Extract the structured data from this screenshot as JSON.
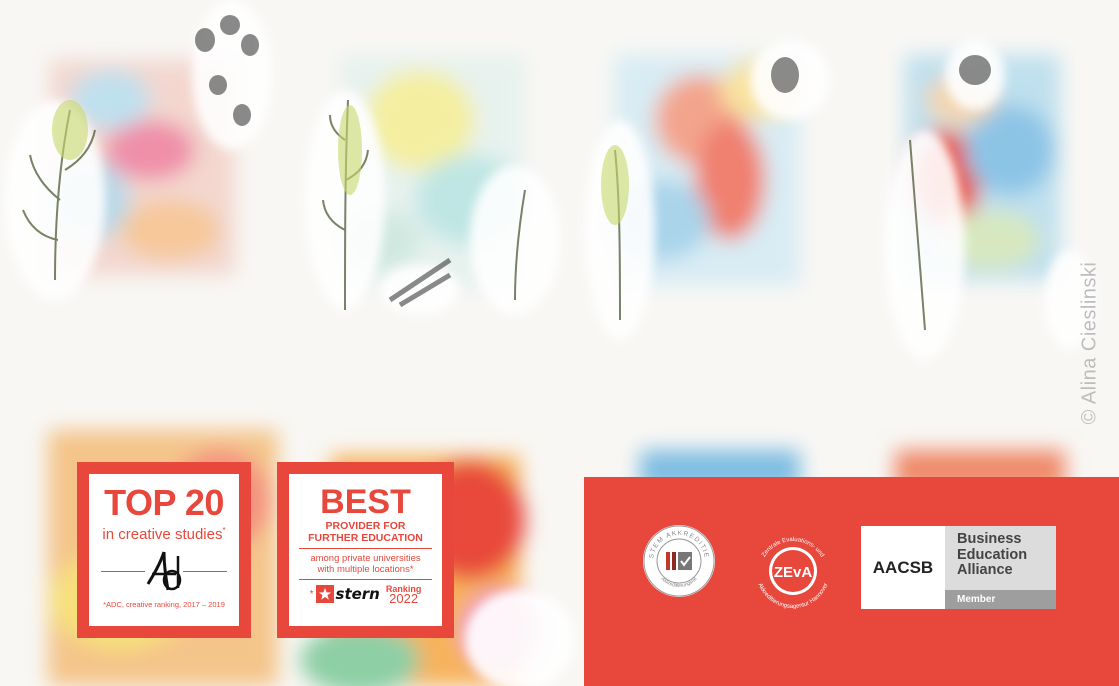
{
  "photo_credit": "© Alina Cieslinski",
  "badges": {
    "top20": {
      "headline": "TOP 20",
      "sub": "in creative studies",
      "sub_mark": "*",
      "footnote": "*ADC, creative ranking, 2017 – 2019"
    },
    "best": {
      "headline": "BEST",
      "line1a": "PROVIDER FOR",
      "line1b": "FURTHER EDUCATION",
      "line2a": "among private universities",
      "line2b": "with multiple locations*",
      "footnote_mark": "*",
      "publisher": "stern",
      "ranking_label": "Ranking",
      "ranking_year": "2022"
    }
  },
  "accreditation": {
    "system_seal": {
      "ring_top": "SYSTEM AKKREDITIERT",
      "ring_bottom": "Akkreditierungsrat"
    },
    "zeva_seal": {
      "logo": "ZEvA",
      "ring_top": "Zentrale Evaluations- und",
      "ring_bottom": "Akkreditierungsagentur Hannover"
    },
    "aacsb": {
      "logo": "AACSB",
      "line1": "Business",
      "line2": "Education",
      "line3": "Alliance",
      "status": "Member"
    }
  },
  "colors": {
    "brand_red": "#e8473c",
    "grey": "#9e9e9e"
  }
}
